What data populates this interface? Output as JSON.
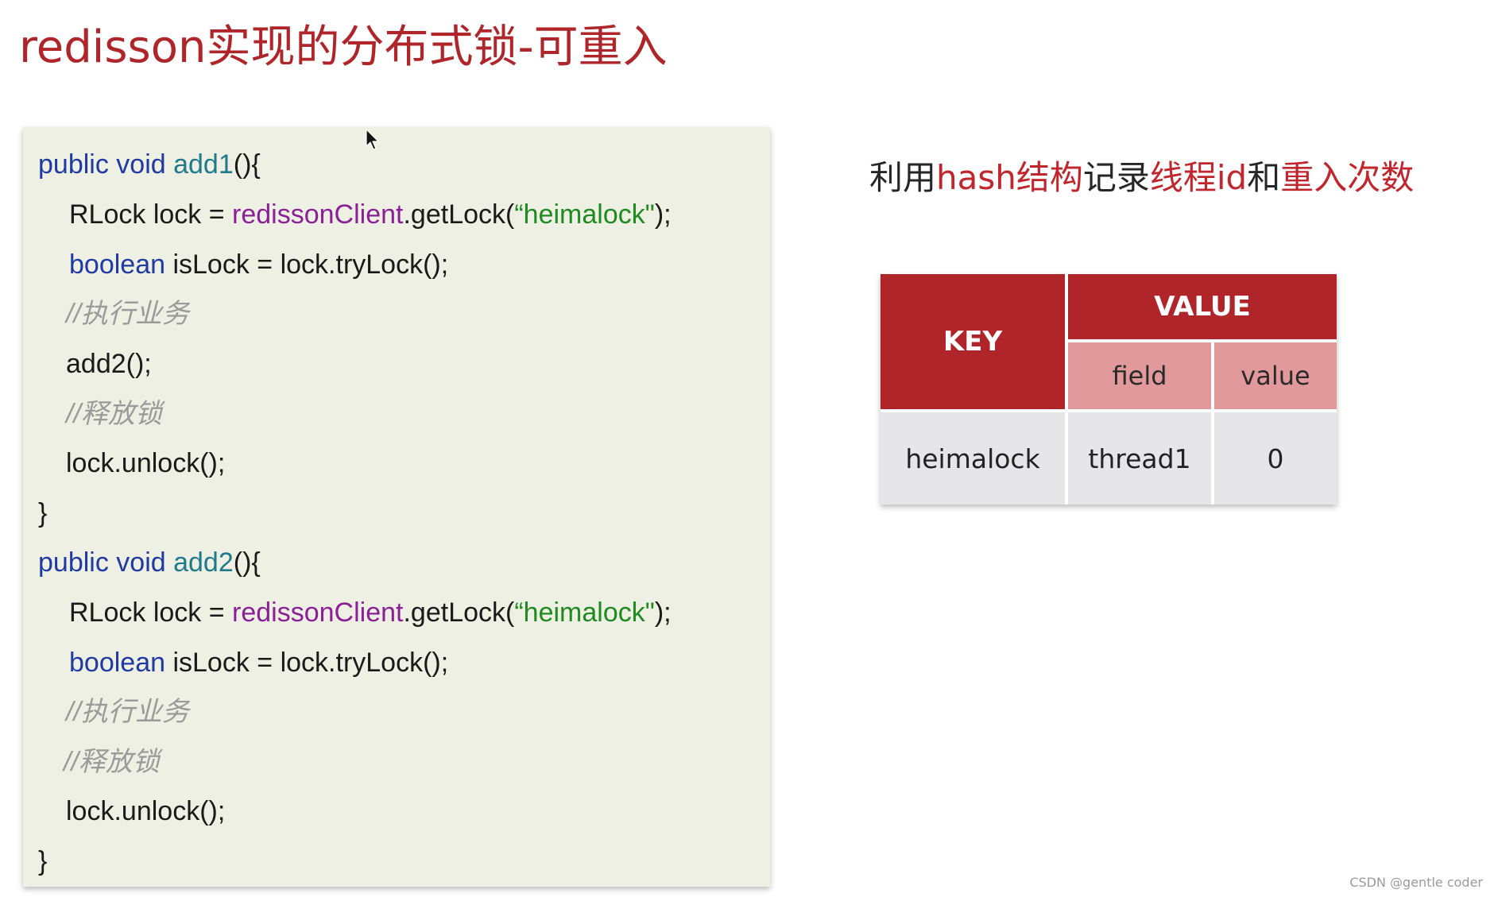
{
  "slide": {
    "title": "redisson实现的分布式锁-可重入",
    "watermark": "CSDN @gentle coder"
  },
  "code": {
    "method1": {
      "sig_kw": "public void",
      "sig_name": "add1",
      "sig_tail": "(){",
      "l1_pre": "RLock lock = ",
      "l1_field": "redissonClient",
      "l1_mid": ".getLock(",
      "l1_str": "“heimalock\"",
      "l1_end": ");",
      "l2_kw": "boolean",
      "l2_rest": " isLock = lock.tryLock();",
      "comment_exec": "//执行业务",
      "call_add2": "add2();",
      "comment_release": "//释放锁",
      "unlock": "lock.unlock();",
      "close": "}"
    },
    "method2": {
      "sig_kw": "public void",
      "sig_name": "add2",
      "sig_tail": "(){",
      "l1_pre": "RLock lock = ",
      "l1_field": "redissonClient",
      "l1_mid": ".getLock(",
      "l1_str": "“heimalock\"",
      "l1_end": ");",
      "l2_kw": "boolean",
      "l2_rest": " isLock = lock.tryLock();",
      "comment_exec": "//执行业务",
      "comment_release": "//释放锁",
      "unlock": "lock.unlock();",
      "close": "}"
    }
  },
  "subtitle": {
    "p1": "利用",
    "p2": "hash结构",
    "p3": "记录",
    "p4": "线程id",
    "p5": "和",
    "p6": "重入次数"
  },
  "hash_table": {
    "key_header": "KEY",
    "value_header": "VALUE",
    "field_header": "field",
    "value_subheader": "value",
    "rows": [
      {
        "key": "heimalock",
        "field": "thread1",
        "value": "0"
      }
    ]
  },
  "colors": {
    "title": "#b0252a",
    "accent": "#c0262c",
    "code_background": "#eef0e4",
    "table_header": "#b0252a",
    "table_subheader": "#e1999c",
    "table_body": "#e6e6e8"
  },
  "icons": {
    "cursor": "mouse-pointer-icon"
  }
}
